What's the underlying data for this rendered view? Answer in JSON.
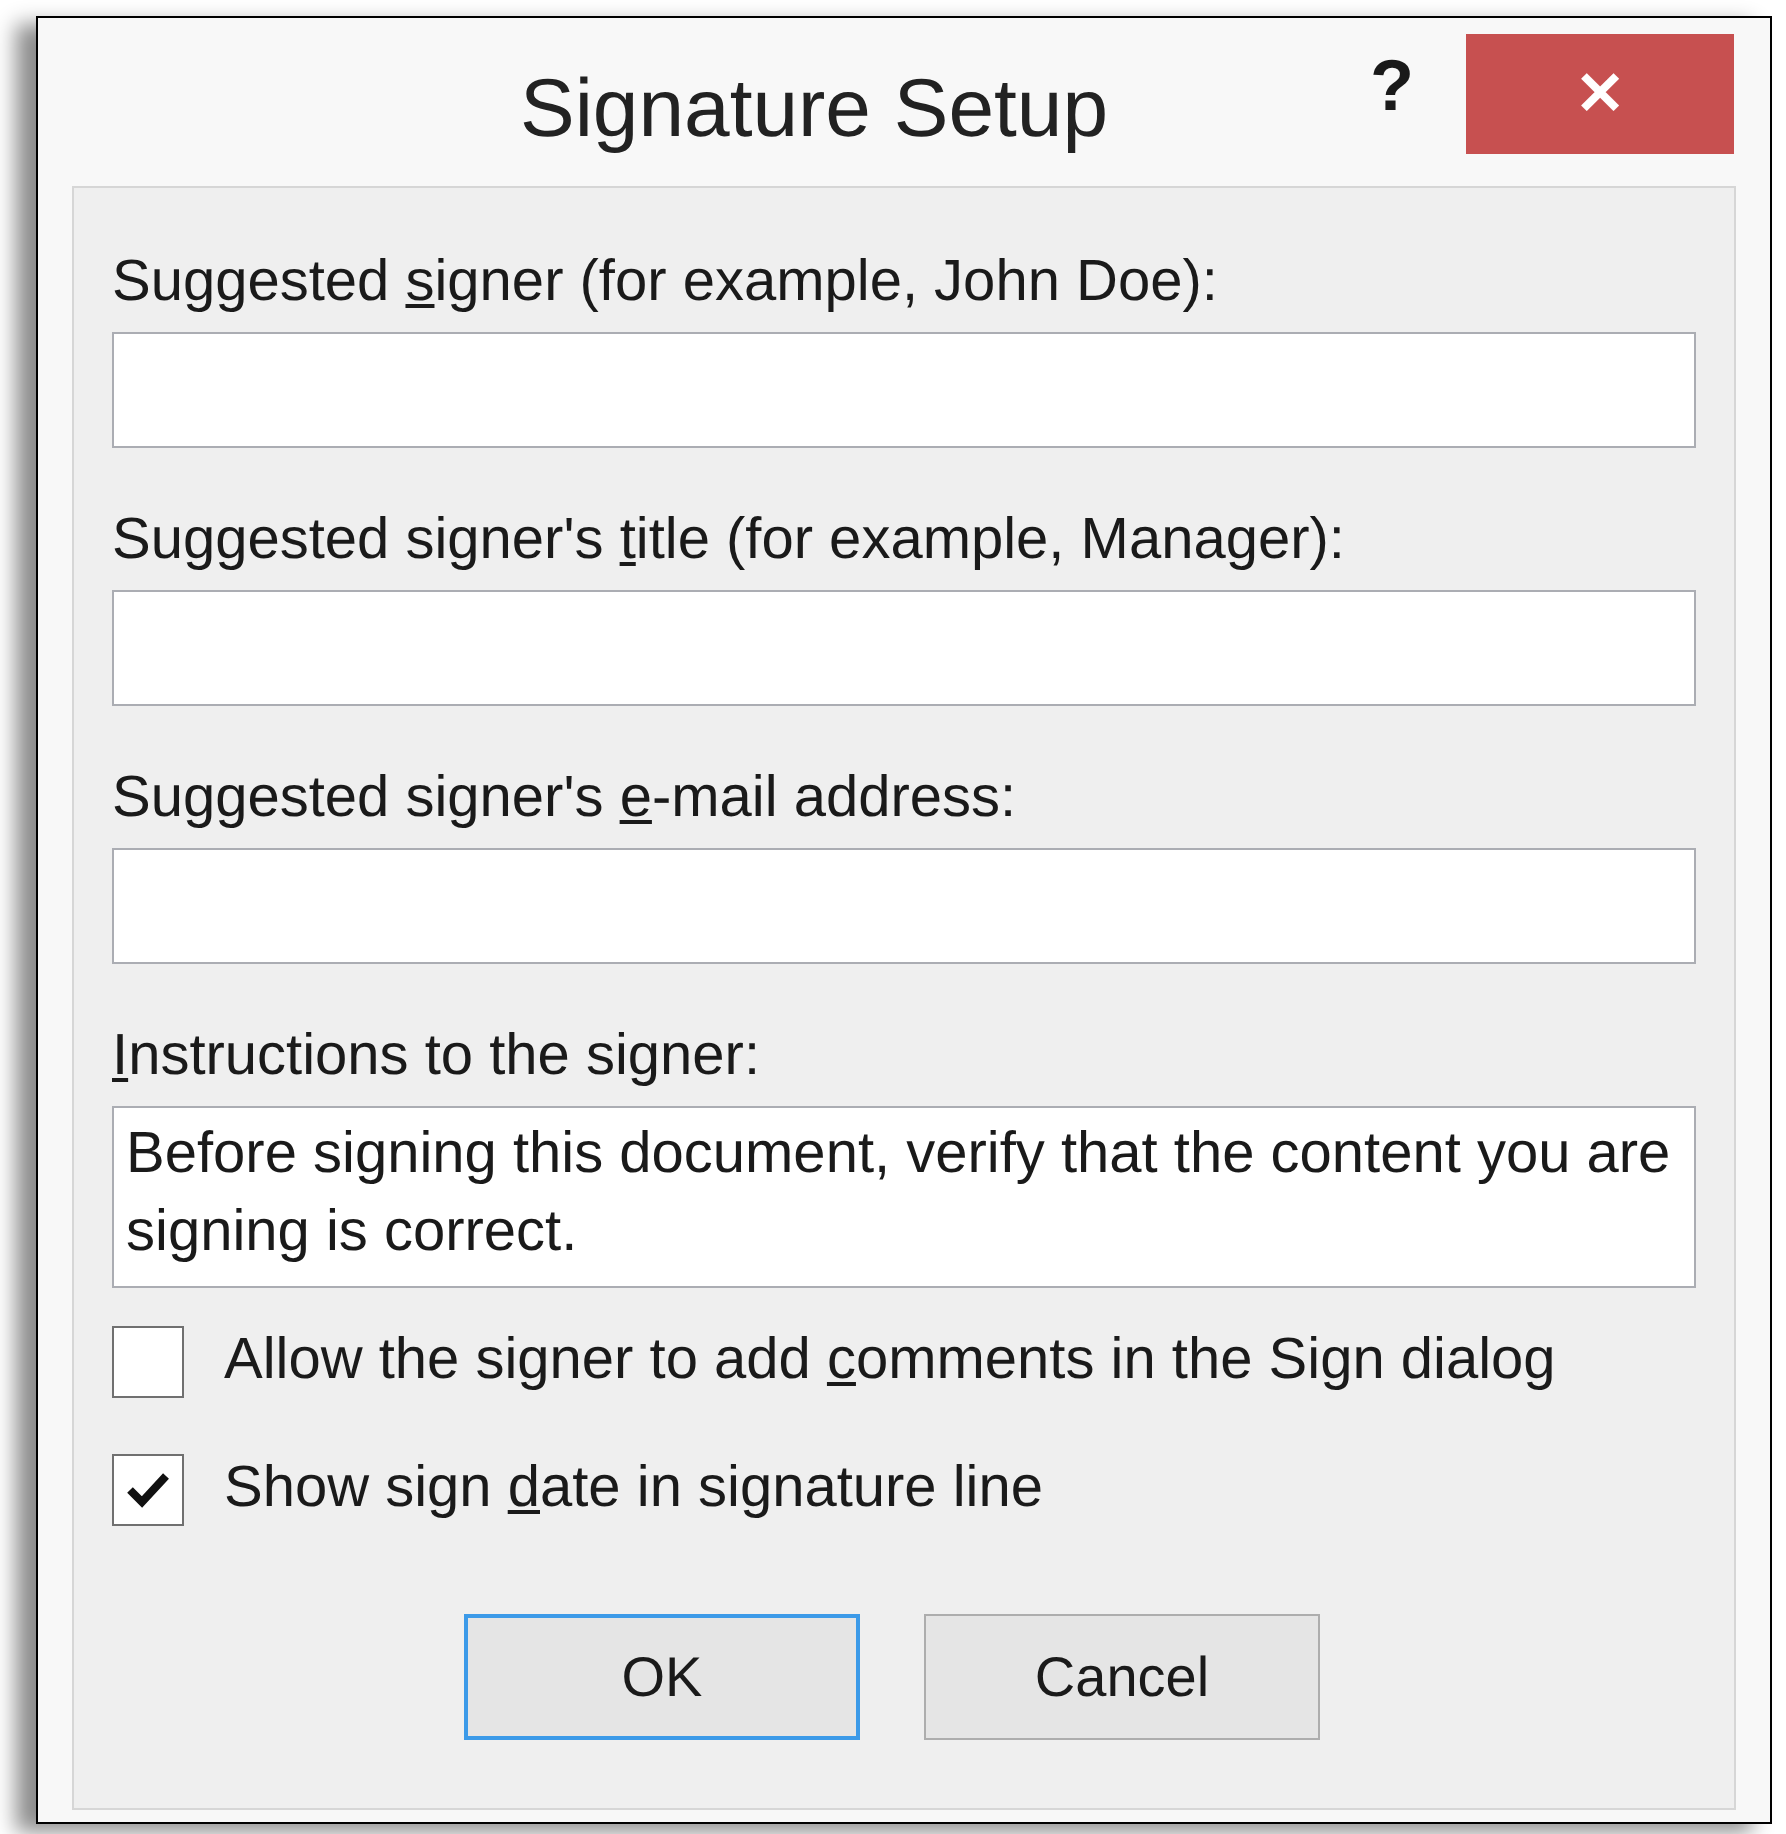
{
  "window": {
    "title": "Signature Setup",
    "help": "?",
    "close": "✕"
  },
  "fields": [
    {
      "kind": "input",
      "label": {
        "before": "Suggested ",
        "key": "s",
        "after": "igner (for example, John Doe):"
      }
    },
    {
      "kind": "input",
      "label": {
        "before": "Suggested signer's ",
        "key": "t",
        "after": "itle (for example, Manager):"
      }
    },
    {
      "kind": "input",
      "label": {
        "before": "Suggested signer's ",
        "key": "e",
        "after": "-mail address:"
      }
    },
    {
      "kind": "textarea",
      "label": {
        "key": "I",
        "after": "nstructions to the signer:"
      },
      "value": "Before signing this document, verify that the content you are signing is correct."
    }
  ],
  "options": [
    {
      "label": {
        "before": "Allow the signer to add ",
        "key": "c",
        "after": "omments in the Sign dialog"
      },
      "checked": false
    },
    {
      "label": {
        "before": "Show sign ",
        "key": "d",
        "after": "ate in signature line"
      },
      "checked": true
    }
  ],
  "buttons": [
    {
      "label": "OK",
      "default": true
    },
    {
      "label": "Cancel",
      "default": false
    }
  ]
}
